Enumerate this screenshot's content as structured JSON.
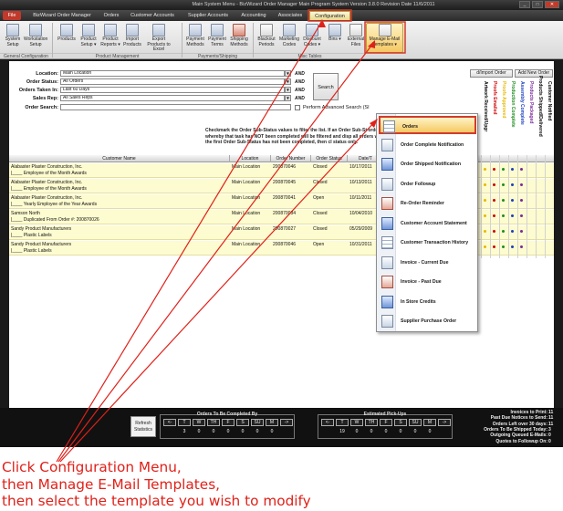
{
  "window": {
    "title": "Main System Menu - BizWizard Order Manager Main Program System  Version 3.8.0  Revision Date 11/6/2011",
    "controls": [
      "_",
      "□",
      "✕"
    ]
  },
  "menubar": {
    "tabs": [
      "File",
      "BizWizard Order Manager",
      "Orders",
      "Customer Accounts",
      "Supplier Accounts",
      "Accounting",
      "Associates",
      "Configuration"
    ]
  },
  "ribbon": {
    "buttons": [
      {
        "label": "System Setup"
      },
      {
        "label": "Workstation Setup"
      },
      {
        "label": "Products"
      },
      {
        "label": "Product Setup ▾"
      },
      {
        "label": "Product Reports ▾"
      },
      {
        "label": "Import Products"
      },
      {
        "label": "Export Products to Excel"
      },
      {
        "label": "Payment Methods"
      },
      {
        "label": "Payment Terms"
      },
      {
        "label": "Shipping Methods"
      },
      {
        "label": "Blackout Periods"
      },
      {
        "label": "Marketing Codes"
      },
      {
        "label": "Discount Codes ▾"
      },
      {
        "label": "Bins ▾"
      },
      {
        "label": "External Files"
      },
      {
        "label": "Manage E-Mail Templates ▾"
      }
    ],
    "groups": [
      "General Configuration",
      "Product Management",
      "Payments/Shipping",
      "Misc Tables"
    ]
  },
  "filters": {
    "location_label": "Location:",
    "location_value": "Main Location",
    "status_label": "Order Status:",
    "status_value": "All Orders",
    "taken_label": "Orders Taken In:",
    "taken_value": "Last 60 Days",
    "salesrep_label": "Sales Rep:",
    "salesrep_value": "All Sales Reps",
    "search_label": "Order Search:",
    "search_value": "",
    "and_label": "AND",
    "search_button": "Search",
    "advanced_label": "Perform Advanced Search (Sl",
    "import_button": "d/Import Order",
    "add_button": "Add New Order"
  },
  "note": {
    "text": "Checkmark the Order Sub-Status values to filter the list.  If an Order Sub-St orders whereby that task has NOT been completed will be filtered and disp all orders where the first Order Sub-Status has not been completed, then cl status only."
  },
  "columns": {
    "vertical": [
      {
        "label": "Artwork Received/Upgr",
        "color": "#000000"
      },
      {
        "label": "Proofs Emailed",
        "color": "#cc0000"
      },
      {
        "label": "Proofs Approved",
        "color": "#e6b800"
      },
      {
        "label": "Production Complete",
        "color": "#1e8c1e"
      },
      {
        "label": "Assembly Complete",
        "color": "#1a3fbf"
      },
      {
        "label": "Products Packaged",
        "color": "#7a2a9a"
      },
      {
        "label": "Products Shipped/Delivered",
        "color": "#000000"
      },
      {
        "label": "Customer Notified",
        "color": "#000000"
      }
    ],
    "headers": [
      "Customer Name",
      "Location",
      "Order Number",
      "Order Status",
      "Date/T"
    ]
  },
  "orders": [
    {
      "customer": "Alabaster Plaster Construction, Inc.",
      "detail": "Employee of the Month Awards",
      "location": "Main Location",
      "number": "200870046",
      "status": "Closed",
      "date": "10/17/2011",
      "dots": [
        "#e6b800",
        "#cc0000",
        "#1e8c1e",
        "#1a3fbf",
        "#7a2a9a"
      ]
    },
    {
      "customer": "Alabaster Plaster Construction, Inc.",
      "detail": "Employee of the Month Awards",
      "location": "Main Location",
      "number": "200870045",
      "status": "Closed",
      "date": "10/13/2011",
      "dots": [
        "#e6b800",
        "#cc0000",
        "#1e8c1e",
        "#1a3fbf",
        "#7a2a9a"
      ]
    },
    {
      "customer": "Alabaster Plaster Construction, Inc.",
      "detail": "Yearly Employee of the Year Awards",
      "location": "Main Location",
      "number": "200870041",
      "status": "Open",
      "date": "10/11/2011",
      "dots": [
        "#e6b800",
        "#cc0000",
        "#1e8c1e",
        "#1a3fbf",
        "#7a2a9a"
      ]
    },
    {
      "customer": "Samson North",
      "detail": "Duplicated From Order #: 200870026",
      "location": "Main Location",
      "number": "200870034",
      "status": "Closed",
      "date": "10/04/2010",
      "dots": [
        "#e6b800",
        "#cc0000",
        "#1e8c1e",
        "#1a3fbf",
        "#7a2a9a"
      ]
    },
    {
      "customer": "Sandy Product Manufacturers",
      "detail": "Plastic Labels",
      "location": "Main Location",
      "number": "200870027",
      "status": "Closed",
      "date": "05/29/2009",
      "dots": [
        "#e6b800",
        "#cc0000",
        "#1e8c1e",
        "#1a3fbf",
        "#7a2a9a"
      ]
    },
    {
      "customer": "Sandy Product Manufacturers",
      "detail": "Plastic Labels",
      "location": "Main Location",
      "number": "200870046",
      "status": "Open",
      "date": "10/31/2011",
      "dots": [
        "#e6b800",
        "#cc0000",
        "#1e8c1e",
        "#1a3fbf",
        "#7a2a9a"
      ]
    }
  ],
  "templates_menu": {
    "items": [
      {
        "label": "Orders",
        "icon": "grid-icon"
      },
      {
        "label": "Order Complete Notification",
        "icon": "flag-icon"
      },
      {
        "label": "Order Shipped Notification",
        "icon": "globe-icon"
      },
      {
        "label": "Order Followup",
        "icon": "phone-icon"
      },
      {
        "label": "Re-Order Reminder",
        "icon": "reorder-icon"
      },
      {
        "label": "Customer Account Statement",
        "icon": "statement-icon"
      },
      {
        "label": "Customer Transaction History",
        "icon": "history-icon"
      },
      {
        "label": "Invoice - Current Due",
        "icon": "invoice-icon"
      },
      {
        "label": "Invoice - Past Due",
        "icon": "pastdue-icon"
      },
      {
        "label": "In Store Credits",
        "icon": "credit-icon"
      },
      {
        "label": "Supplier Purchase Order",
        "icon": "purchase-icon"
      }
    ]
  },
  "statusbar": {
    "refresh_label": "Refresh Statistics",
    "completed_caption": "Orders To Be Completed By",
    "pickup_caption": "Estimated Pick-Ups",
    "days": [
      "<-",
      "T",
      "W",
      "TH",
      "F",
      "S",
      "SU",
      "M",
      "->"
    ],
    "completed_counts": [
      "3",
      "0",
      "0",
      "0",
      "0",
      "0",
      "0"
    ],
    "pickup_counts": [
      "19",
      "0",
      "0",
      "0",
      "0",
      "0",
      "0"
    ],
    "stats": [
      {
        "label": "Invoices to Print:",
        "value": "11"
      },
      {
        "label": "Past Due Notices to Send:",
        "value": "11"
      },
      {
        "label": "Orders Left over 30 days:",
        "value": "11"
      },
      {
        "label": "Orders To Be Shipped Today:",
        "value": "3"
      },
      {
        "label": "Outgoing Queued E-Mails:",
        "value": "0"
      },
      {
        "label": "Quotes to Followup On:",
        "value": "0"
      }
    ]
  },
  "caption": {
    "line1": "Click Configuration Menu,",
    "line2": "then Manage E-Mail Templates,",
    "line3": "then select the template you wish to modify"
  },
  "colors": {
    "annotation": "#e0211a",
    "row_highlight": "#fdfbd0",
    "selected_item": "#f5c863"
  }
}
